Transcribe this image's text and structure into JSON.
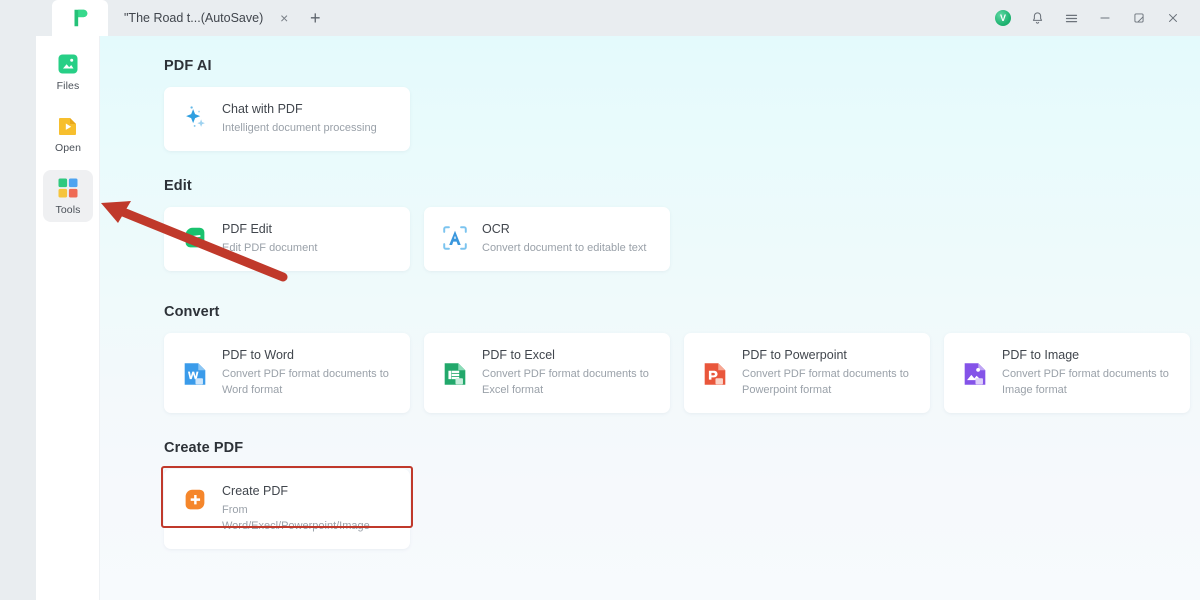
{
  "app": {
    "logo_name": "pdf-app-logo",
    "accent_cyan": "#e4fafc",
    "highlight_red": "#c0392b"
  },
  "titlebar": {
    "tab_title": "\"The Road t...(AutoSave)",
    "tab_close_label": "×",
    "new_tab_label": "+",
    "avatar_initial": "V",
    "controls": [
      {
        "name": "account-avatar",
        "label": ""
      },
      {
        "name": "notifications-bell-icon",
        "label": ""
      },
      {
        "name": "main-menu-icon",
        "label": ""
      },
      {
        "name": "minimize-button",
        "label": ""
      },
      {
        "name": "maximize-button",
        "label": ""
      },
      {
        "name": "close-button",
        "label": ""
      }
    ]
  },
  "sidebar": {
    "items": [
      {
        "label": "Files",
        "icon": "files-icon",
        "active": false
      },
      {
        "label": "Open",
        "icon": "open-icon",
        "active": false
      },
      {
        "label": "Tools",
        "icon": "tools-icon",
        "active": true
      }
    ]
  },
  "main": {
    "sections": [
      {
        "title": "PDF AI",
        "cards": [
          {
            "title": "Chat with PDF",
            "subtitle": "Intelligent document processing",
            "icon": "ai-sparkle-icon"
          }
        ]
      },
      {
        "title": "Edit",
        "cards": [
          {
            "title": "PDF Edit",
            "subtitle": "Edit PDF document",
            "icon": "pdf-edit-icon"
          },
          {
            "title": "OCR",
            "subtitle": "Convert document to editable text",
            "icon": "ocr-icon"
          }
        ]
      },
      {
        "title": "Convert",
        "cards": [
          {
            "title": "PDF to Word",
            "subtitle": "Convert PDF format documents to Word format",
            "icon": "word-icon"
          },
          {
            "title": "PDF to Excel",
            "subtitle": "Convert PDF format documents to Excel format",
            "icon": "excel-icon"
          },
          {
            "title": "PDF to Powerpoint",
            "subtitle": "Convert PDF format documents to Powerpoint format",
            "icon": "powerpoint-icon"
          },
          {
            "title": "PDF to Image",
            "subtitle": "Convert PDF format documents to Image format",
            "icon": "image-icon"
          }
        ]
      },
      {
        "title": "Create PDF",
        "cards": [
          {
            "title": "Create PDF",
            "subtitle": "From Word/Execl/Powerpoint/Image",
            "icon": "create-pdf-icon",
            "highlighted": true
          }
        ]
      }
    ]
  },
  "annotation": {
    "arrow_name": "red-pointer-arrow",
    "arrow_color": "#c0392b"
  }
}
